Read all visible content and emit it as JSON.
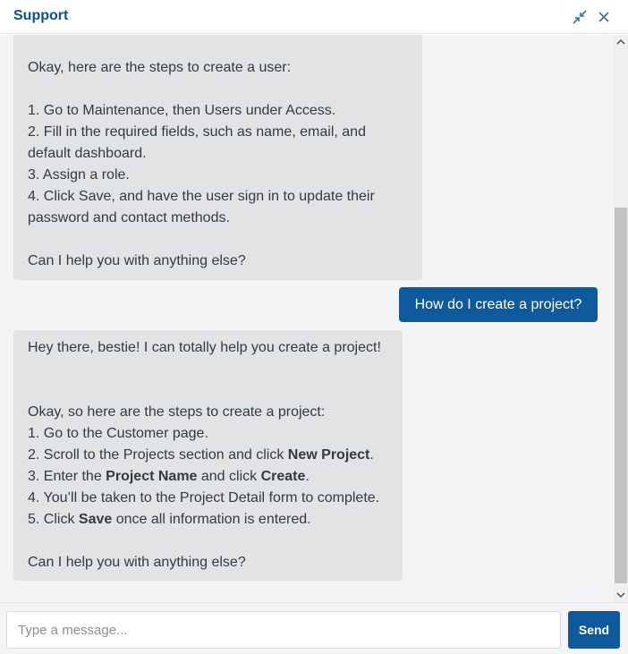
{
  "header": {
    "title": "Support",
    "icons": [
      "collapse-icon",
      "close-icon"
    ],
    "accent_color": "#0d4f8c"
  },
  "messages": {
    "bot1": {
      "lines": [
        "Okay, here are the steps to create a user:",
        "",
        "1. Go to Maintenance, then Users under Access.",
        "2. Fill in the required fields, such as name, email, and",
        "default dashboard.",
        "3. Assign a role.",
        "4. Click Save, and have the user sign in to update their",
        "password and contact methods.",
        "",
        "Can I help you with anything else?"
      ]
    },
    "user1": {
      "text": "How do I create a project?"
    },
    "bot2": {
      "greeting": "Hey there, bestie! I can totally help you create a project!",
      "intro": "Okay, so here are the steps to create a project:",
      "step1": "1. Go to the Customer page.",
      "step2_pre": "2. Scroll to the Projects section and click ",
      "step2_bold": "New Project",
      "step2_post": ".",
      "step3_pre": "3. Enter the ",
      "step3_bold1": "Project Name",
      "step3_mid": " and click ",
      "step3_bold2": "Create",
      "step3_post": ".",
      "step4": "4. You’ll be taken to the Project Detail form to complete.",
      "step5_pre": "5. Click ",
      "step5_bold": "Save",
      "step5_post": " once all information is entered.",
      "closing": "Can I help you with anything else?"
    }
  },
  "composer": {
    "placeholder": "Type a message...",
    "send_label": "Send"
  },
  "colors": {
    "bot_bubble": "#e2e3e5",
    "user_bubble": "#0f5a9c",
    "chat_bg": "#f3f4f6"
  }
}
